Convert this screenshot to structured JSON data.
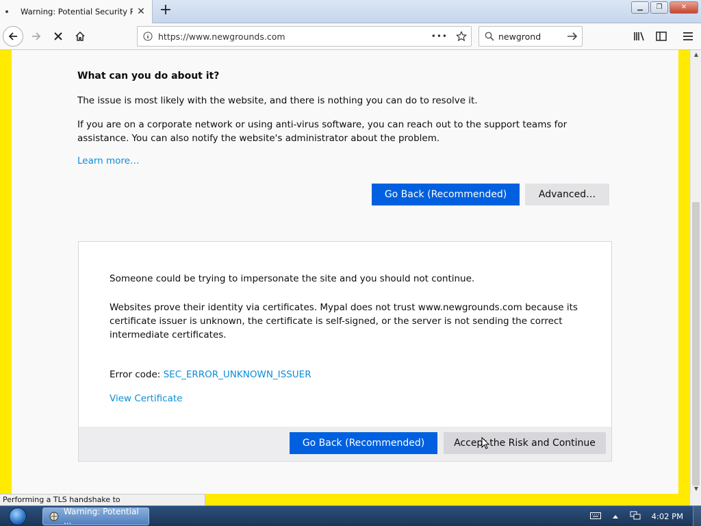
{
  "tab": {
    "title": "Warning: Potential Security Risk Ahead",
    "close_label": "✕"
  },
  "new_tab_label": "+",
  "window_controls": {
    "minimize": "▁",
    "maximize": "❐",
    "close": "✕"
  },
  "toolbar": {
    "url": "https://www.newgrounds.com",
    "search_value": "newgrond",
    "page_actions_label": "•••"
  },
  "content": {
    "heading": "What can you do about it?",
    "para1": "The issue is most likely with the website, and there is nothing you can do to resolve it.",
    "para2": "If you are on a corporate network or using anti-virus software, you can reach out to the support teams for assistance. You can also notify the website's administrator about the problem.",
    "learn_more": "Learn more…",
    "go_back_label": "Go Back (Recommended)",
    "advanced_label": "Advanced…"
  },
  "advanced_panel": {
    "para1": "Someone could be trying to impersonate the site and you should not continue.",
    "para2": "Websites prove their identity via certificates. Mypal does not trust www.newgrounds.com because its certificate issuer is unknown, the certificate is self-signed, or the server is not sending the correct intermediate certificates.",
    "error_label": "Error code: ",
    "error_code": "SEC_ERROR_UNKNOWN_ISSUER",
    "view_certificate": "View Certificate",
    "go_back_label": "Go Back (Recommended)",
    "accept_label": "Accept the Risk and Continue"
  },
  "status_text": "Performing a TLS handshake to www.newgrounds.com…",
  "taskbar": {
    "item_label": "Warning: Potential ...",
    "clock": "4:02 PM"
  },
  "colors": {
    "accent_blue": "#0060df",
    "link_blue": "#0a8dd9",
    "page_border_yellow": "#ffea00"
  }
}
